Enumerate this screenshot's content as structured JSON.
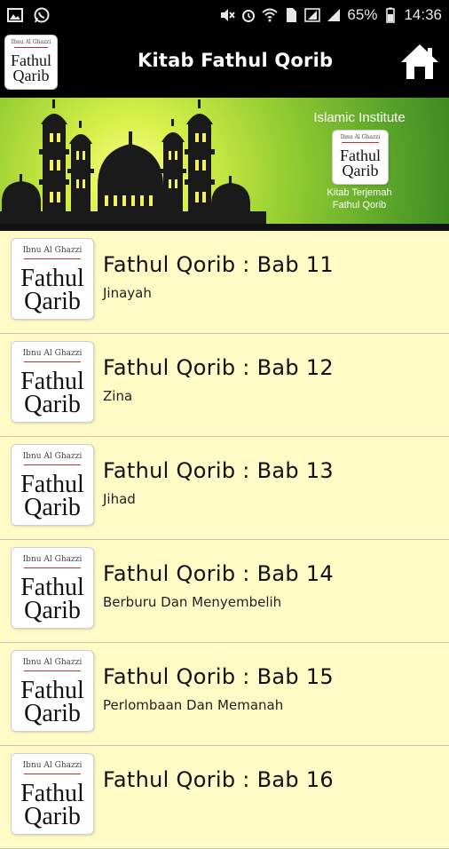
{
  "status_bar": {
    "battery_percent": "65%",
    "time": "14:36",
    "icons": [
      "image-icon",
      "whatsapp-icon",
      "mute-icon",
      "alarm-icon",
      "wifi-icon",
      "sim-icon",
      "signal-icon",
      "battery-icon"
    ]
  },
  "app_bar": {
    "title": "Kitab Fathul Qorib",
    "logo": {
      "top_text": "Ibnu Al Ghazzi",
      "line1": "Fathul",
      "line2": "Qarib"
    }
  },
  "banner": {
    "institute": "Islamic Institute",
    "logo": {
      "top_text": "Ibnu Al Ghazzi",
      "line1": "Fathul",
      "line2": "Qarib"
    },
    "caption_line1": "Kitab Terjemah",
    "caption_line2": "Fathul Qorib",
    "colors": {
      "sky_light": "#fbff90",
      "sky_dark": "#3f8a22",
      "silhouette": "#1a1a1a",
      "window": "#f3f060"
    }
  },
  "list": {
    "items": [
      {
        "title": "Fathul Qorib  : Bab 11",
        "subtitle": "Jinayah"
      },
      {
        "title": "Fathul Qorib  : Bab 12",
        "subtitle": "Zina"
      },
      {
        "title": "Fathul Qorib  : Bab 13",
        "subtitle": "Jihad"
      },
      {
        "title": "Fathul Qorib  : Bab 14",
        "subtitle": "Berburu Dan Menyembelih"
      },
      {
        "title": "Fathul Qorib  : Bab 15",
        "subtitle": "Perlombaan Dan Memanah"
      },
      {
        "title": "Fathul Qorib  : Bab 16",
        "subtitle": ""
      }
    ],
    "thumb": {
      "top_text": "Ibnu Al Ghazzi",
      "line1": "Fathul",
      "line2": "Qarib"
    }
  },
  "colors": {
    "list_bg": "#fffbc6",
    "bar_bg": "#000000",
    "divider": "#c8c8b0"
  }
}
